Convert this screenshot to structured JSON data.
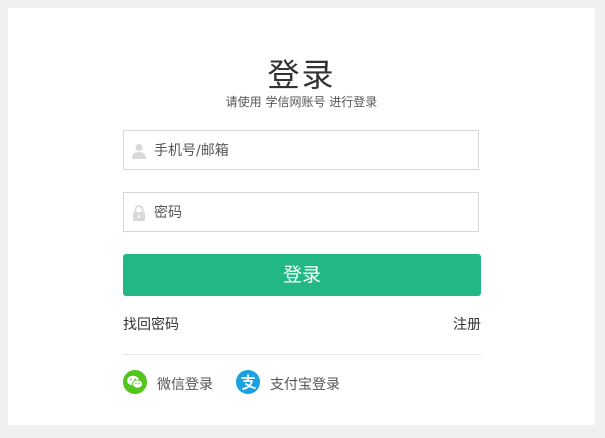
{
  "header": {
    "title": "登录",
    "subtitle": "请使用 学信网账号 进行登录"
  },
  "form": {
    "username_placeholder": "手机号/邮箱",
    "username_value": "",
    "username_icon": "user-icon",
    "password_placeholder": "密码",
    "password_value": "",
    "password_icon": "lock-icon",
    "login_label": "登录"
  },
  "links": {
    "forgot_password": "找回密码",
    "register": "注册"
  },
  "social": {
    "wechat": {
      "label": "微信登录",
      "icon": "wechat-icon",
      "color": "#52c41a"
    },
    "alipay": {
      "label": "支付宝登录",
      "icon": "alipay-icon",
      "color": "#1ba1e2"
    }
  },
  "colors": {
    "accent": "#22b884",
    "background": "#eef0f1"
  }
}
